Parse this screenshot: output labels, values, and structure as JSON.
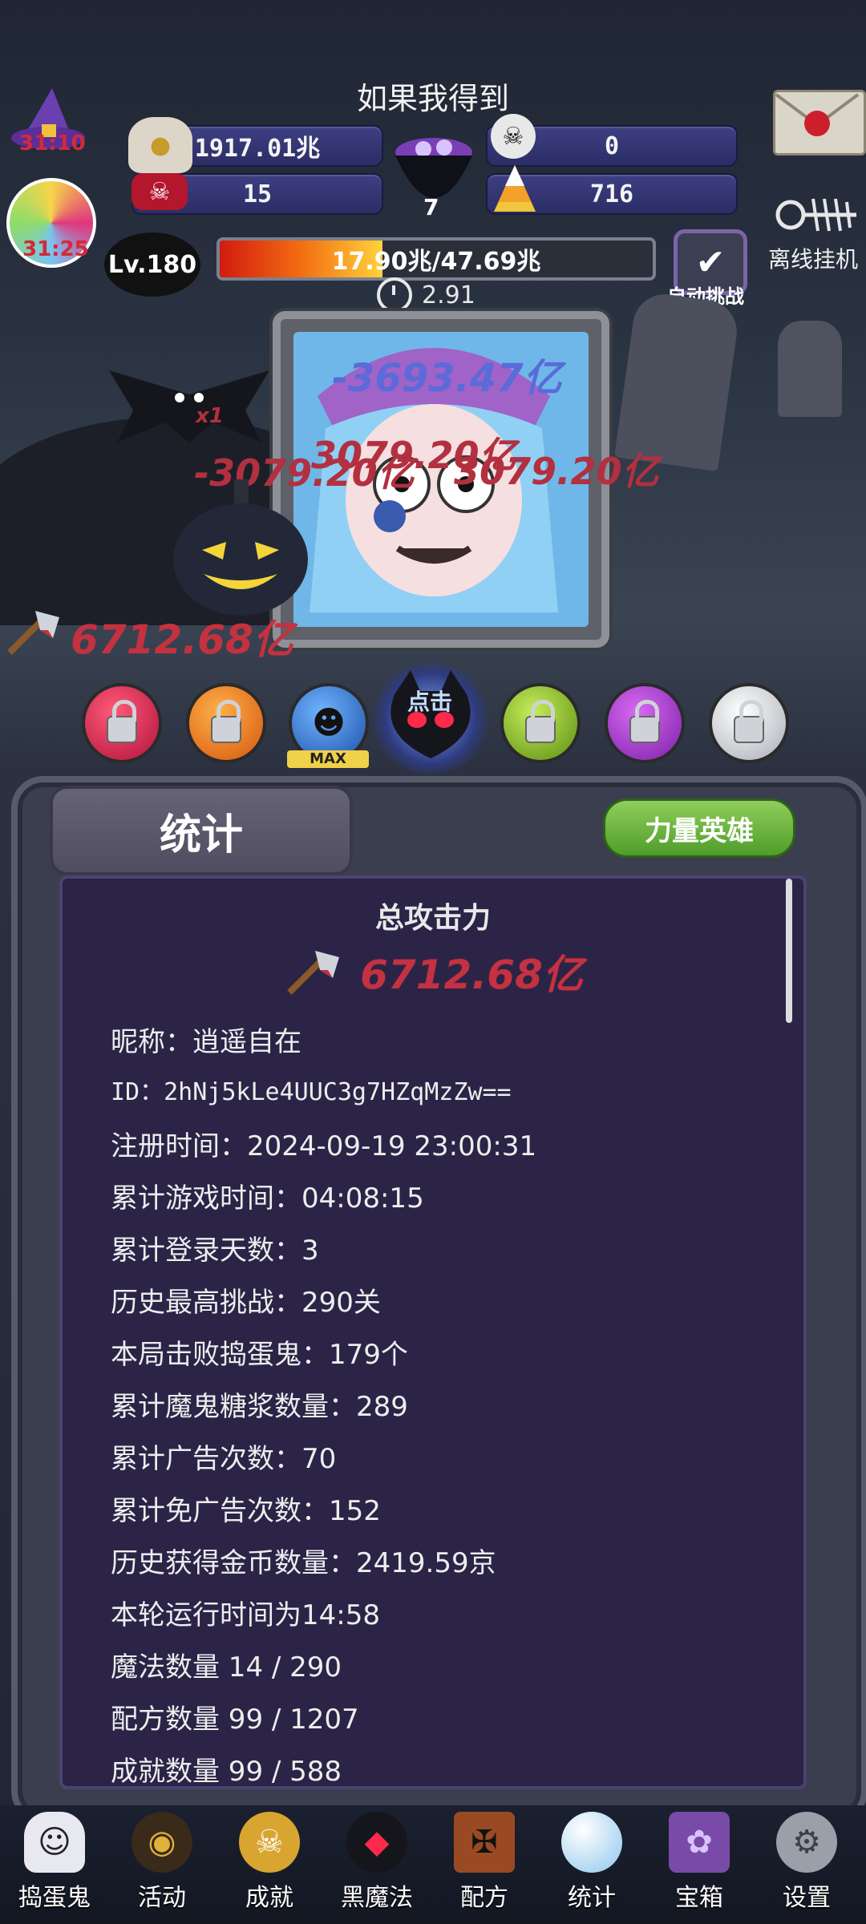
{
  "header": {
    "title": "如果我得到",
    "resources": {
      "gold": "1917.01兆",
      "skull_count": "0",
      "candy_bones": "15",
      "candy_corn": "716",
      "cauldron_count": "7",
      "hat_timer": "31:10",
      "lollipop_timer": "31:25"
    },
    "level": "Lv.180",
    "hp_text": "17.90兆/47.69兆",
    "hp_fraction": 0.375,
    "timer": "2.91",
    "auto_challenge": "自动挑战",
    "offline_idle": "离线挂机"
  },
  "battle": {
    "damage_numbers": [
      "-3693.47亿",
      "-3079.20亿",
      "3079.20亿",
      "3079.20亿"
    ],
    "bat_multiplier": "x1",
    "attack_power": "6712.68亿",
    "tap_hint": "点击",
    "max_label": "MAX"
  },
  "panel": {
    "tab_label": "统计",
    "hero_button": "力量英雄",
    "title": "总攻击力",
    "power": "6712.68亿",
    "stats": [
      "昵称：逍遥自在",
      "ID：2hNj5kLe4UUC3g7HZqMzZw==",
      "注册时间：2024-09-19 23:00:31",
      "累计游戏时间：04:08:15",
      "累计登录天数：3",
      "历史最高挑战：290关",
      "本局击败捣蛋鬼：179个",
      "累计魔鬼糖浆数量：289",
      "累计广告次数：70",
      "累计免广告次数：152",
      "历史获得金币数量：2419.59京",
      "本轮运行时间为14:58",
      "魔法数量 14 / 290",
      "配方数量 99 / 1207",
      "成就数量 99 / 588"
    ]
  },
  "nav": {
    "items": [
      "捣蛋鬼",
      "活动",
      "成就",
      "黑魔法",
      "配方",
      "统计",
      "宝箱",
      "设置"
    ]
  },
  "colors": {
    "damage_red": "#c43140",
    "panel_purple": "#2b2447",
    "hero_button_green": "#5aa82e"
  }
}
